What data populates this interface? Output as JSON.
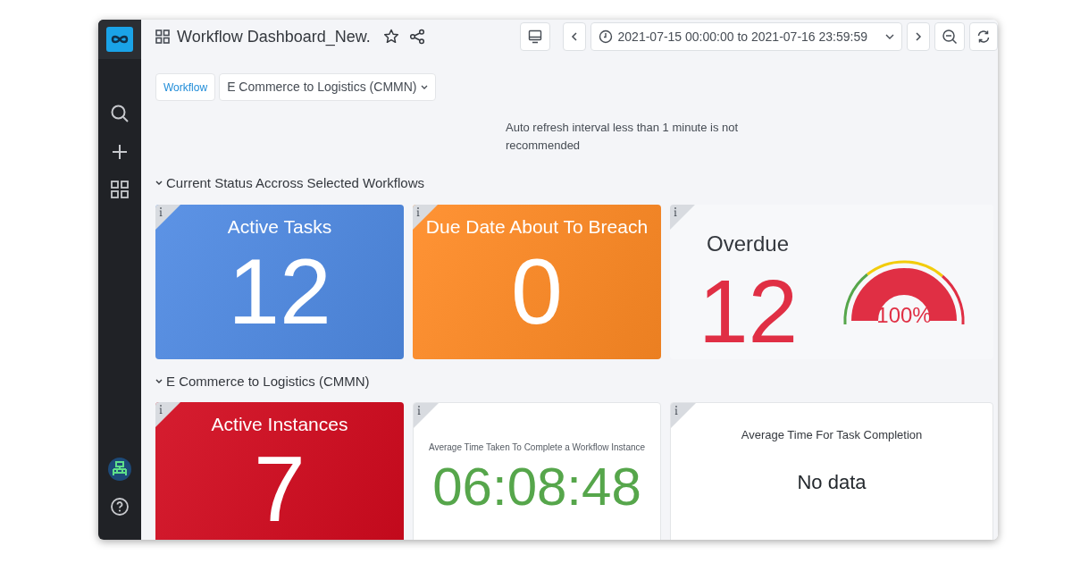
{
  "header": {
    "title": "Workflow Dashboard_New.",
    "time_range": "2021-07-15 00:00:00 to 2021-07-16 23:59:59"
  },
  "variables": [
    {
      "label": "Workflow",
      "value": "E Commerce to Logistics (CMMN)"
    }
  ],
  "notice": "Auto refresh interval less than 1 minute is not recommended",
  "rows": [
    {
      "title": "Current Status Accross Selected Workflows",
      "expanded": true,
      "panels": [
        {
          "kind": "stat",
          "title": "Active Tasks",
          "value": "12",
          "color": "#4f8ae3"
        },
        {
          "kind": "stat",
          "title": "Due Date About To Breach",
          "value": "0",
          "color": "#ff8a24"
        },
        {
          "kind": "gauge",
          "title": "Overdue",
          "value": "12",
          "color": "#e02f44",
          "gauge": {
            "level": 1,
            "reading": "100%"
          }
        }
      ]
    },
    {
      "title": "E Commerce to Logistics (CMMN)",
      "expanded": true,
      "panels": [
        {
          "kind": "stat",
          "title": "Active Instances",
          "value": "7",
          "color": "#d20a1e"
        },
        {
          "kind": "text",
          "title": "Average Time Taken To Complete a Workflow Instance",
          "value": "06:08:48",
          "color": "#56a64b"
        },
        {
          "kind": "nodata",
          "title": "Average Time For Task Completion",
          "value": "No data"
        }
      ]
    }
  ]
}
